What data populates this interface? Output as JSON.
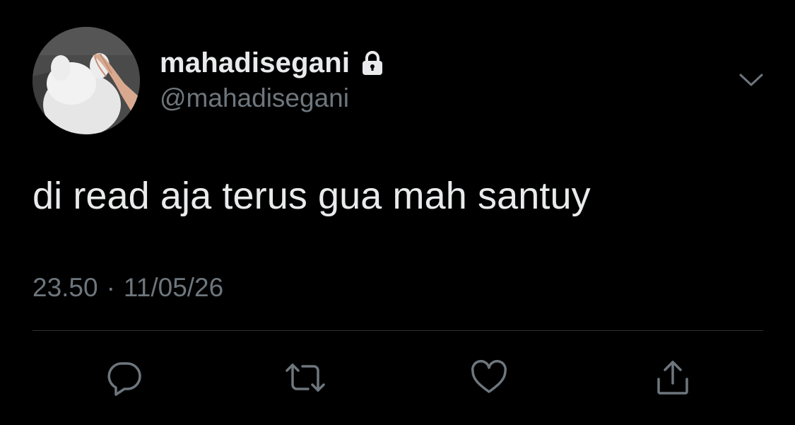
{
  "tweet": {
    "display_name": "mahadisegani",
    "handle": "@mahadisegani",
    "text": "di read aja terus gua mah santuy",
    "time": "23.50",
    "separator": "·",
    "date": "11/05/26"
  },
  "icons": {
    "lock": "lock-icon",
    "chevron": "chevron-down-icon",
    "reply": "reply-icon",
    "retweet": "retweet-icon",
    "like": "heart-icon",
    "share": "share-icon"
  },
  "colors": {
    "background": "#000000",
    "primary_text": "#e9eaeb",
    "secondary_text": "#6e767d",
    "divider": "#2f3336"
  }
}
